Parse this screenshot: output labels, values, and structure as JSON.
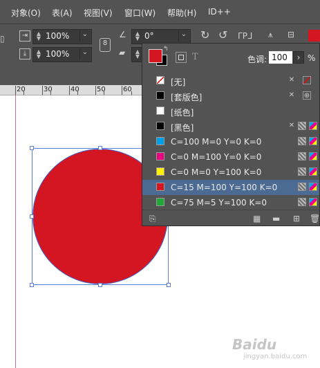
{
  "menu": [
    "对象(O)",
    "表(A)",
    "视图(V)",
    "窗口(W)",
    "帮助(H)",
    "ID++"
  ],
  "control_bar": {
    "scale_x": "100%",
    "scale_y": "100%",
    "rotate": "0°",
    "ref_point_label": "P"
  },
  "ruler": {
    "labels": [
      "20",
      "30",
      "40",
      "50",
      "60"
    ]
  },
  "swatches_panel": {
    "tint_label": "色调:",
    "tint_value": "100",
    "tint_unit": "%",
    "fill_color": "#d31622",
    "items": [
      {
        "name": "[无]",
        "color": "none"
      },
      {
        "name": "[套版色]",
        "color": "#000000"
      },
      {
        "name": "[纸色]",
        "color": "#ffffff"
      },
      {
        "name": "[黑色]",
        "color": "#000000"
      },
      {
        "name": "C=100 M=0 Y=0 K=0",
        "color": "#00a0e9"
      },
      {
        "name": "C=0 M=100 Y=0 K=0",
        "color": "#e4007f"
      },
      {
        "name": "C=0 M=0 Y=100 K=0",
        "color": "#fff100"
      },
      {
        "name": "C=15 M=100 Y=100 K=0",
        "color": "#d31622",
        "selected": true
      },
      {
        "name": "C=75 M=5 Y=100 K=0",
        "color": "#1fa737"
      }
    ]
  },
  "watermark": {
    "brand": "Baidu",
    "sub": "jingyan.baidu.com"
  }
}
